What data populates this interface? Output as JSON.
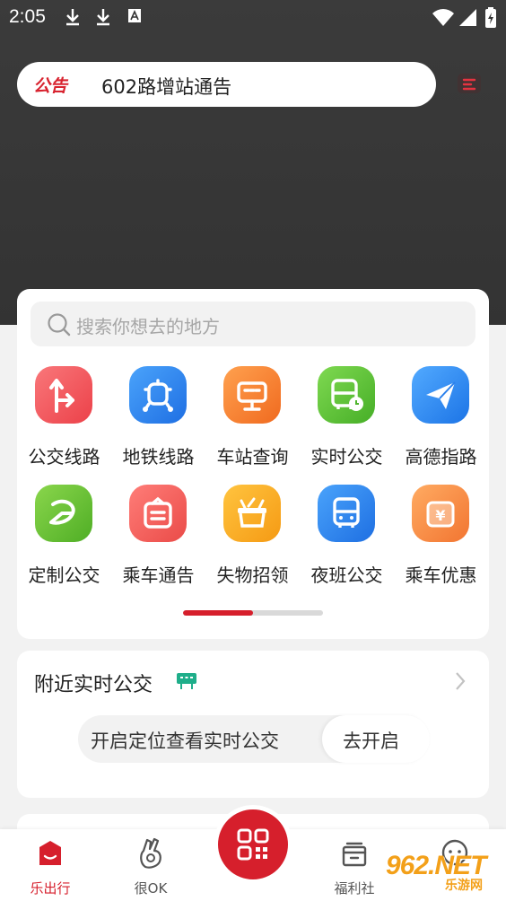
{
  "status_bar": {
    "time": "2:05"
  },
  "notice": {
    "tag": "公告",
    "text": "602路增站通告"
  },
  "search": {
    "placeholder": "搜索你想去的地方"
  },
  "services": [
    {
      "label": "公交线路",
      "icon": "route-icon",
      "color": "#f2575b"
    },
    {
      "label": "地铁线路",
      "icon": "subway-icon",
      "color": "#2e86f0"
    },
    {
      "label": "车站查询",
      "icon": "station-sign-icon",
      "color": "#f6822f"
    },
    {
      "label": "实时公交",
      "icon": "realtime-bus-icon",
      "color": "#5cc23a"
    },
    {
      "label": "高德指路",
      "icon": "paper-plane-icon",
      "color": "#2c8ef2"
    },
    {
      "label": "定制公交",
      "icon": "custom-bus-icon",
      "color": "#6ac13a"
    },
    {
      "label": "乘车通告",
      "icon": "notice-card-icon",
      "color": "#f0605c"
    },
    {
      "label": "失物招领",
      "icon": "basket-icon",
      "color": "#f7a624"
    },
    {
      "label": "夜班公交",
      "icon": "night-bus-icon",
      "color": "#2f86ee"
    },
    {
      "label": "乘车优惠",
      "icon": "coupon-icon",
      "color": "#f49146"
    }
  ],
  "pager": {
    "progress": 0.5
  },
  "nearby": {
    "title": "附近实时公交",
    "prompt": "开启定位查看实时公交",
    "button": "去开启"
  },
  "tabs": [
    {
      "label": "乐出行",
      "icon": "home-bag-icon",
      "active": true
    },
    {
      "label": "很OK",
      "icon": "ok-hand-icon",
      "active": false
    },
    {
      "label": "福利社",
      "icon": "gift-box-icon",
      "active": false
    },
    {
      "label": "",
      "icon": "chat-icon",
      "active": false
    }
  ],
  "watermark": {
    "main": "962.NET",
    "sub": "乐游网"
  },
  "colors": {
    "accent": "#d61f2c",
    "hero": "#353535"
  }
}
